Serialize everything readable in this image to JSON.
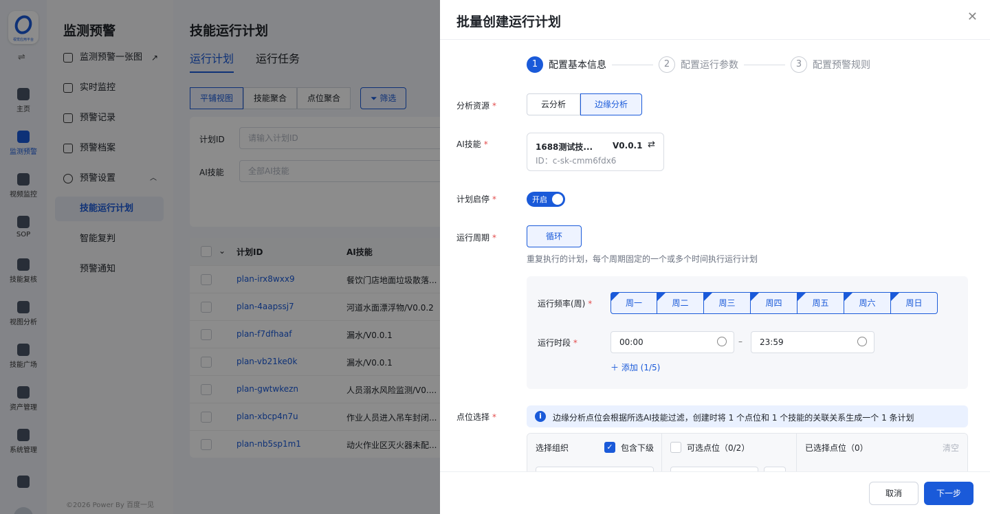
{
  "rail": {
    "logo_text": "视觉应用平台",
    "items": [
      {
        "label": "主页",
        "icon": "home-icon"
      },
      {
        "label": "监测预警",
        "icon": "monitor-chart-icon"
      },
      {
        "label": "视频监控",
        "icon": "camera-icon"
      },
      {
        "label": "SOP",
        "icon": "sop-icon"
      },
      {
        "label": "技能复核",
        "icon": "target-icon"
      },
      {
        "label": "视图分析",
        "icon": "image-search-icon"
      },
      {
        "label": "技能广场",
        "icon": "cluster-icon"
      },
      {
        "label": "资产管理",
        "icon": "asset-icon"
      },
      {
        "label": "系统管理",
        "icon": "system-icon"
      }
    ]
  },
  "subnav": {
    "title": "监测预警",
    "items": [
      {
        "label": "监测预警一张图",
        "icon": "pie-icon"
      },
      {
        "label": "实时监控",
        "icon": "chart-icon"
      },
      {
        "label": "预警记录",
        "icon": "bell-icon"
      },
      {
        "label": "预警档案",
        "icon": "archive-icon"
      },
      {
        "label": "预警设置",
        "icon": "settings-icon"
      },
      {
        "label": "技能运行计划"
      },
      {
        "label": "智能复判"
      },
      {
        "label": "预警通知"
      }
    ],
    "footer": "©2026 Power By 百度一见"
  },
  "main": {
    "title": "技能运行计划",
    "tabs": [
      "运行计划",
      "运行任务"
    ],
    "view_buttons": [
      "平铺视图",
      "技能聚合",
      "点位聚合"
    ],
    "filter_label": "筛选",
    "filters": {
      "plan_id_label": "计划ID",
      "plan_id_placeholder": "请输入计划ID",
      "skill_label": "AI技能",
      "skill_value": "全部AI技能"
    },
    "table": {
      "headers": [
        "计划ID",
        "AI技能"
      ],
      "rows": [
        {
          "id": "plan-irx8wxx9",
          "skill": "餐饮门店地面垃圾散落..."
        },
        {
          "id": "plan-4aapssj7",
          "skill": "河道水面漂浮物/V0.0.2"
        },
        {
          "id": "plan-f7dfhaaf",
          "skill": "漏水/V0.0.1"
        },
        {
          "id": "plan-vb21ke0k",
          "skill": "漏水/V0.0.1"
        },
        {
          "id": "plan-gwtwkezn",
          "skill": "人员溺水风险监测/V0...."
        },
        {
          "id": "plan-xbcp4n7u",
          "skill": "作业人员进入吊车封闭..."
        },
        {
          "id": "plan-nb5sp1m1",
          "skill": "动火作业区灭火器未配..."
        }
      ]
    }
  },
  "drawer": {
    "title": "批量创建运行计划",
    "steps": [
      {
        "num": "1",
        "label": "配置基本信息"
      },
      {
        "num": "2",
        "label": "配置运行参数"
      },
      {
        "num": "3",
        "label": "配置预警规则"
      }
    ],
    "labels": {
      "resource": "分析资源",
      "skill": "AI技能",
      "enable": "计划启停",
      "cycle": "运行周期",
      "points": "点位选择"
    },
    "resource_options": [
      "云分析",
      "边缘分析"
    ],
    "skill_card": {
      "name": "1688测试技...",
      "version": "V0.0.1",
      "id": "ID：c-sk-cmm6fdx6"
    },
    "switch_text": "开启",
    "cycle_button": "循环",
    "cycle_hint": "重复执行的计划，每个周期固定的一个或多个时间执行运行计划",
    "freq_label": "运行频率(周)",
    "time_label": "运行时段",
    "days": [
      "周一",
      "周二",
      "周三",
      "周四",
      "周五",
      "周六",
      "周日"
    ],
    "time_start": "00:00",
    "time_sep": "–",
    "time_end": "23:59",
    "add_label": "添加  (1/5)",
    "info_text": "边缘分析点位会根据所选AI技能过滤，创建时将 1 个点位和 1 个技能的关联关系生成一个 1 条计划",
    "org_label": "选择组织",
    "include_sub": "包含下级",
    "optional_points": "可选点位（0/2）",
    "selected_points": "已选择点位（0）",
    "clear": "清空",
    "cancel": "取消",
    "next": "下一步"
  }
}
